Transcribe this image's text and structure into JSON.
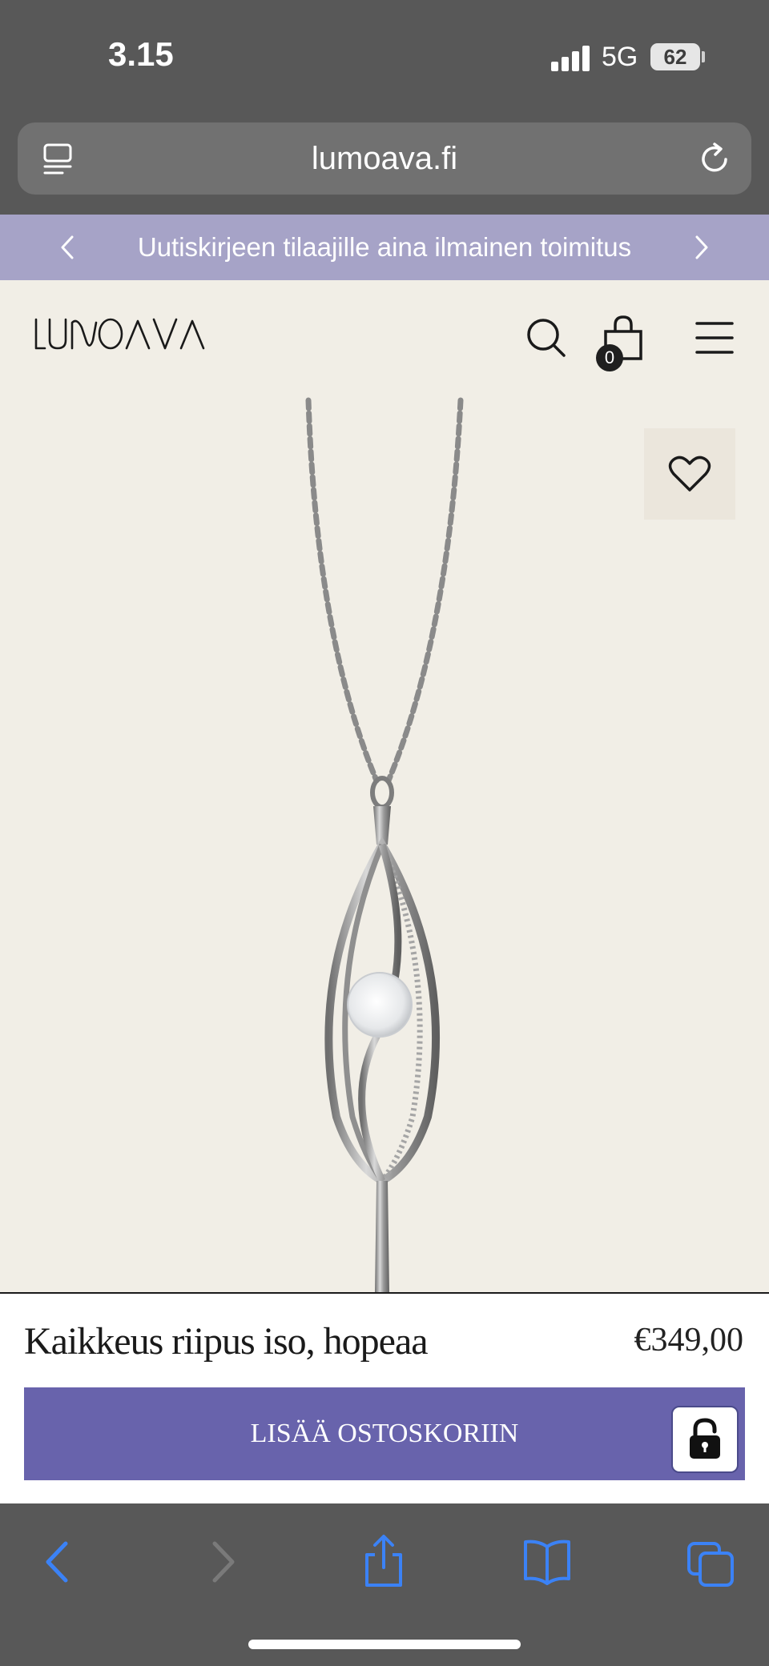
{
  "status_bar": {
    "time": "3.15",
    "network": "5G",
    "battery": "62"
  },
  "browser": {
    "url": "lumoava.fi"
  },
  "promo": {
    "text": "Uutiskirjeen tilaajille aina ilmainen toimitus"
  },
  "header": {
    "logo_text": "LUMOAVA",
    "cart_count": "0"
  },
  "product": {
    "title": "Kaikkeus riipus iso, hopeaa",
    "price": "€349,00",
    "add_to_cart_label": "LISÄÄ OSTOSKORIIN"
  },
  "colors": {
    "promo_banner": "#a6a3c7",
    "accent_button": "#6863ac",
    "page_background": "#f1eee6",
    "browser_chrome": "#585858",
    "toolbar_icons": "#3b82f6"
  },
  "icons": {
    "url_bar_left": "tabs-list-icon",
    "url_bar_right": "reload-icon",
    "header": [
      "search-icon",
      "shopping-bag-icon",
      "hamburger-menu-icon"
    ],
    "product": "heart-icon",
    "lock": "lock-icon",
    "toolbar": [
      "back-arrow-icon",
      "forward-arrow-icon",
      "share-icon",
      "bookmarks-icon",
      "tabs-icon"
    ]
  }
}
